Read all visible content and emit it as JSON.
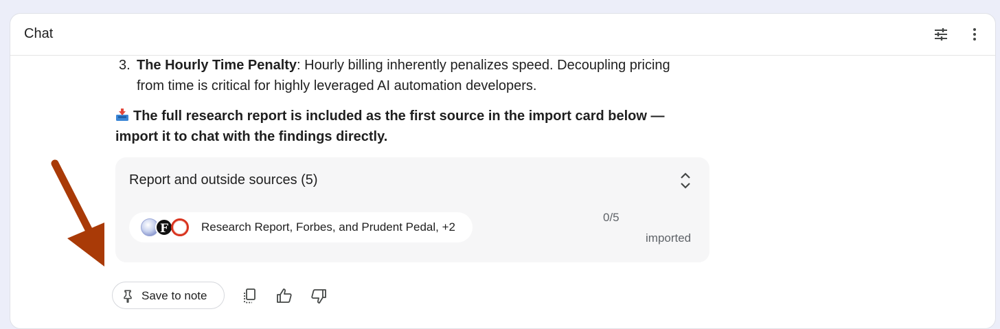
{
  "header": {
    "title": "Chat",
    "icons": [
      "tune-icon",
      "more-vert-icon"
    ]
  },
  "message": {
    "list_number": "3.",
    "item_bold": "The Hourly Time Penalty",
    "item_rest_line1": ": Hourly billing inherently penalizes speed. Decoupling pricing",
    "item_line2": "from time is critical for highly leveraged AI automation developers.",
    "import_note_line1": "The full research report is included as the first source in the import card below —",
    "import_note_line2": "import it to chat with the findings directly.",
    "import_note_icon": "inbox-tray-icon"
  },
  "sources_card": {
    "title": "Report and outside sources (5)",
    "chip_label": "Research Report, Forbes, and Prudent Pedal, +2",
    "favicon_letter": "F",
    "imported_count": "0/5",
    "imported_label": "imported"
  },
  "actions": {
    "save_label": "Save to note"
  },
  "colors": {
    "background": "#eceef9",
    "card": "#f6f6f7",
    "arrow": "#a93a07"
  }
}
